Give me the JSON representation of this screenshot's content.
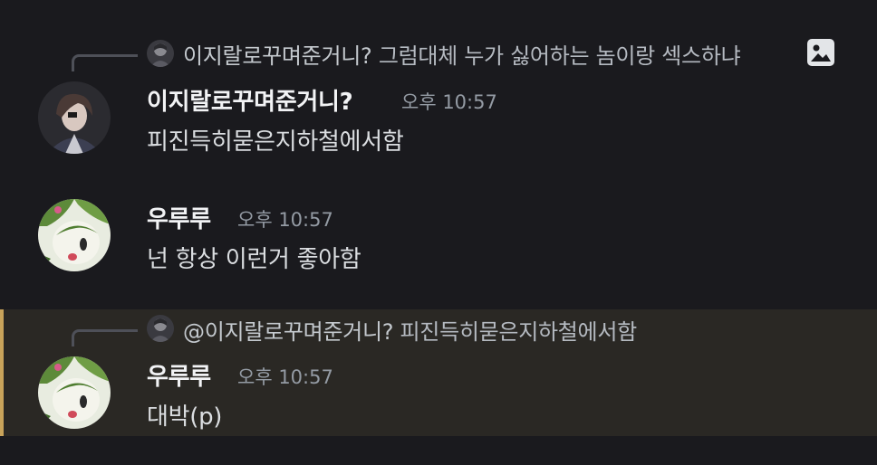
{
  "messages": [
    {
      "reply": {
        "author": "이지랄로꾸며준거니?",
        "text": "그럼대체 누가 싫어하는 놈이랑 섹스하냐",
        "has_image_icon": true,
        "image_icon": "image-icon"
      },
      "author": "이지랄로꾸며준거니?",
      "time": "오후 10:57",
      "text": "피진득히묻은지하철에서함",
      "avatar": "dark-haired-character-avatar",
      "highlighted": false
    },
    {
      "author": "우루루",
      "time": "오후 10:57",
      "text": "넌 항상 이런거 좋아함",
      "avatar": "green-creature-avatar",
      "highlighted": false
    },
    {
      "reply": {
        "author": "@이지랄로꾸며준거니?",
        "text": "피진득히묻은지하철에서함"
      },
      "author": "우루루",
      "time": "오후 10:57",
      "text": "대박(p)",
      "avatar": "green-creature-avatar",
      "highlighted": true
    }
  ],
  "colors": {
    "background": "#1a1a1e",
    "highlight_background": "#2a2824",
    "mention_bar": "#c8a35a"
  }
}
